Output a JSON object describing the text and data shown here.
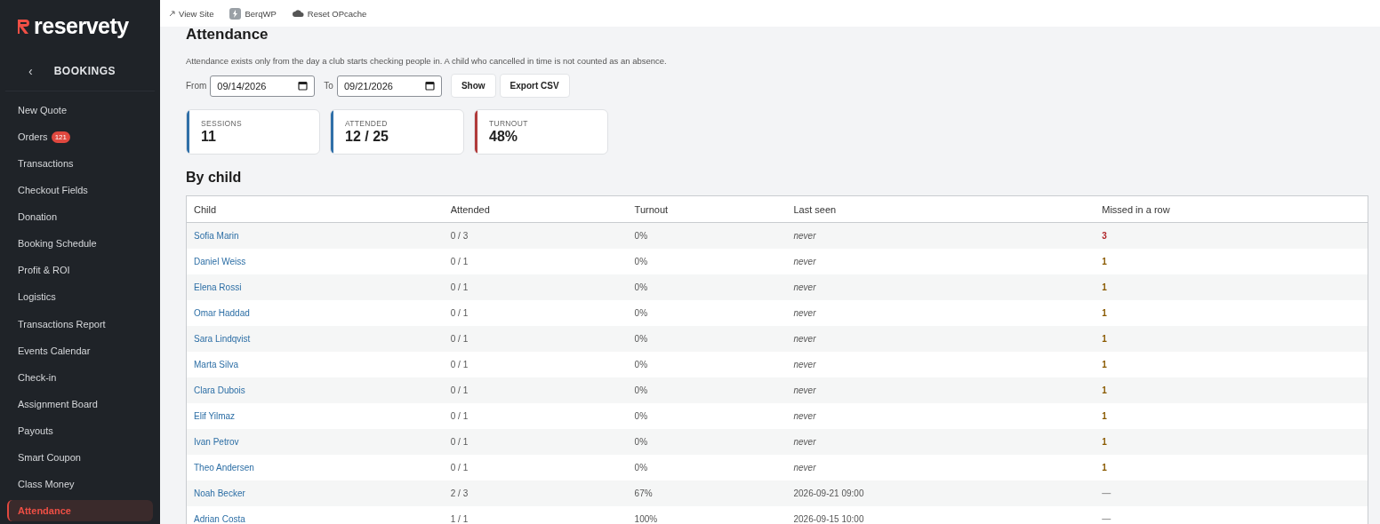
{
  "sidebar": {
    "logo": "reservety",
    "section": "BOOKINGS",
    "back": "‹",
    "items": [
      {
        "label": "New Quote",
        "selected": false
      },
      {
        "label": "Orders",
        "badge": "121",
        "selected": false
      },
      {
        "label": "Transactions",
        "selected": false
      },
      {
        "label": "Checkout Fields",
        "selected": false
      },
      {
        "label": "Donation",
        "selected": false
      },
      {
        "label": "Booking Schedule",
        "selected": false
      },
      {
        "label": "Profit & ROI",
        "selected": false
      },
      {
        "label": "Logistics",
        "selected": false
      },
      {
        "label": "Transactions Report",
        "selected": false
      },
      {
        "label": "Events Calendar",
        "selected": false
      },
      {
        "label": "Check-in",
        "selected": false
      },
      {
        "label": "Assignment Board",
        "selected": false
      },
      {
        "label": "Payouts",
        "selected": false
      },
      {
        "label": "Smart Coupon",
        "selected": false
      },
      {
        "label": "Class Money",
        "selected": false
      },
      {
        "label": "Attendance",
        "selected": true
      }
    ]
  },
  "topbar": {
    "links": [
      {
        "kind": "external",
        "label": "View Site"
      },
      {
        "kind": "plugin",
        "label": "BerqWP"
      },
      {
        "kind": "cache",
        "label": "Reset OPcache"
      }
    ]
  },
  "page": {
    "title": "Attendance",
    "description": "Attendance exists only from the day a club starts checking people in. A child who cancelled in time is not counted as an absence.",
    "filters": {
      "from_label": "From",
      "from_value": "09/14/2026",
      "to_label": "To",
      "to_value": "09/21/2026",
      "buttons": [
        "Show",
        "Export CSV"
      ]
    },
    "stats": [
      {
        "label": "SESSIONS",
        "value": "11",
        "color": "#2f6fa8"
      },
      {
        "label": "ATTENDED",
        "value": "12 / 25",
        "color": "#2f6fa8"
      },
      {
        "label": "TURNOUT",
        "value": "48%",
        "color": "#b03a3a"
      }
    ],
    "section_title": "By child",
    "table": {
      "columns": [
        "Child",
        "Attended",
        "Turnout",
        "Last seen",
        "Missed in a row"
      ],
      "rows": [
        {
          "child": "Sofia Marin",
          "attended": "0 / 3",
          "turnout": "0%",
          "last_seen": "never",
          "never": true,
          "missed": "3",
          "color": "#b0262a"
        },
        {
          "child": "Daniel Weiss",
          "attended": "0 / 1",
          "turnout": "0%",
          "last_seen": "never",
          "never": true,
          "missed": "1",
          "color": "#8a5a00"
        },
        {
          "child": "Elena Rossi",
          "attended": "0 / 1",
          "turnout": "0%",
          "last_seen": "never",
          "never": true,
          "missed": "1",
          "color": "#8a5a00"
        },
        {
          "child": "Omar Haddad",
          "attended": "0 / 1",
          "turnout": "0%",
          "last_seen": "never",
          "never": true,
          "missed": "1",
          "color": "#8a5a00"
        },
        {
          "child": "Sara Lindqvist",
          "attended": "0 / 1",
          "turnout": "0%",
          "last_seen": "never",
          "never": true,
          "missed": "1",
          "color": "#8a5a00"
        },
        {
          "child": "Marta Silva",
          "attended": "0 / 1",
          "turnout": "0%",
          "last_seen": "never",
          "never": true,
          "missed": "1",
          "color": "#8a5a00"
        },
        {
          "child": "Clara Dubois",
          "attended": "0 / 1",
          "turnout": "0%",
          "last_seen": "never",
          "never": true,
          "missed": "1",
          "color": "#8a5a00"
        },
        {
          "child": "Elif Yilmaz",
          "attended": "0 / 1",
          "turnout": "0%",
          "last_seen": "never",
          "never": true,
          "missed": "1",
          "color": "#8a5a00"
        },
        {
          "child": "Ivan Petrov",
          "attended": "0 / 1",
          "turnout": "0%",
          "last_seen": "never",
          "never": true,
          "missed": "1",
          "color": "#8a5a00"
        },
        {
          "child": "Theo Andersen",
          "attended": "0 / 1",
          "turnout": "0%",
          "last_seen": "never",
          "never": true,
          "missed": "1",
          "color": "#8a5a00"
        },
        {
          "child": "Noah Becker",
          "attended": "2 / 3",
          "turnout": "67%",
          "last_seen": "2026-09-21 09:00",
          "never": false,
          "missed": "—",
          "color": "#999999"
        },
        {
          "child": "Adrian Costa",
          "attended": "1 / 1",
          "turnout": "100%",
          "last_seen": "2026-09-15 10:00",
          "never": false,
          "missed": "—",
          "color": "#999999"
        }
      ]
    }
  }
}
